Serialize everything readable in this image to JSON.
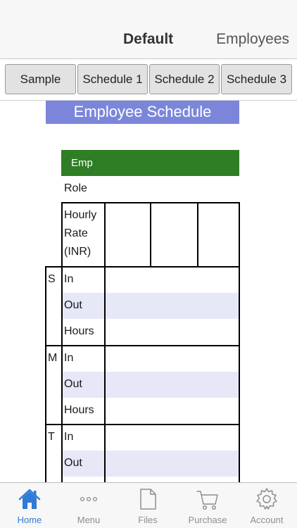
{
  "nav": {
    "title": "Default",
    "right": "Employees"
  },
  "sheet_tabs": [
    "Sample",
    "Schedule 1",
    "Schedule 2",
    "Schedule 3"
  ],
  "sheet": {
    "title": "Employee Schedule",
    "header": "Emp",
    "role_label": "Role",
    "rate_lines": [
      "Hourly",
      "Rate",
      "(INR)"
    ],
    "days": [
      {
        "letter": "S",
        "rows": [
          "In",
          "Out",
          "Hours"
        ]
      },
      {
        "letter": "M",
        "rows": [
          "In",
          "Out",
          "Hours"
        ]
      },
      {
        "letter": "T",
        "rows": [
          "In",
          "Out"
        ]
      }
    ]
  },
  "tabbar": {
    "items": [
      {
        "label": "Home",
        "icon": "house-icon",
        "active": true
      },
      {
        "label": "Menu",
        "icon": "more-dots-icon",
        "active": false
      },
      {
        "label": "Files",
        "icon": "file-icon",
        "active": false
      },
      {
        "label": "Purchase",
        "icon": "cart-icon",
        "active": false
      },
      {
        "label": "Account",
        "icon": "gear-icon",
        "active": false
      }
    ]
  },
  "colors": {
    "title_banner": "#7b86db",
    "header_green": "#2f7d25",
    "row_shade": "#e6e8f8",
    "active_tab": "#2f7bd6",
    "inactive_tab": "#8e8e8e"
  }
}
